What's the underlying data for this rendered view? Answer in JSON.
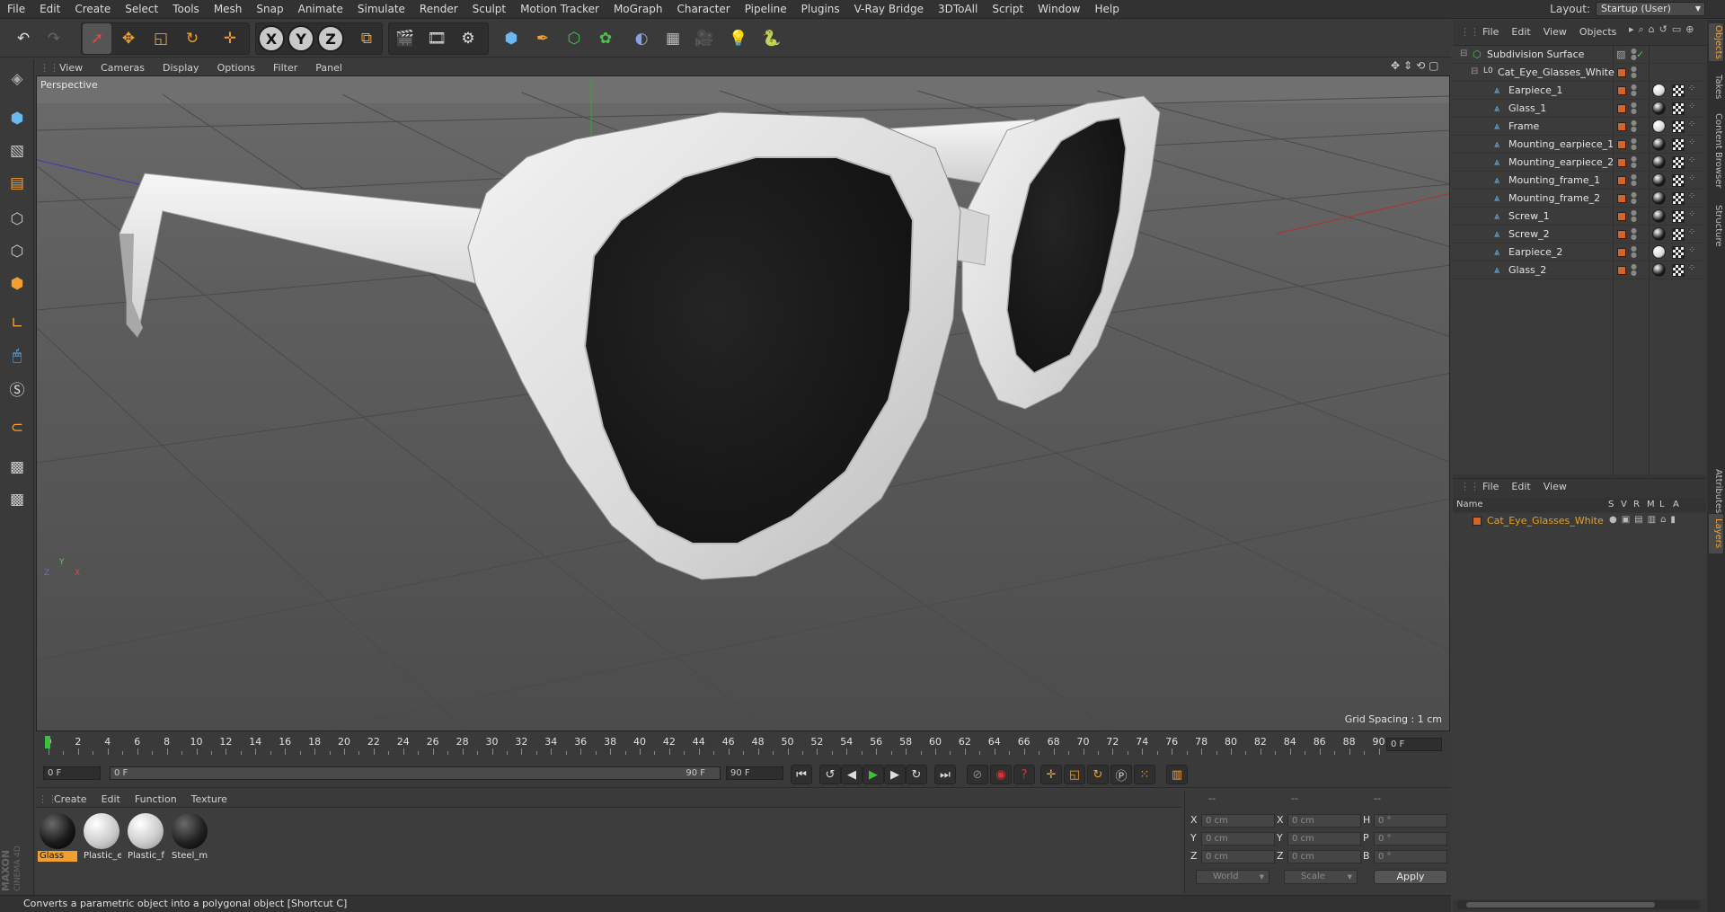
{
  "menubar": {
    "items": [
      "File",
      "Edit",
      "Create",
      "Select",
      "Tools",
      "Mesh",
      "Snap",
      "Animate",
      "Simulate",
      "Render",
      "Sculpt",
      "Motion Tracker",
      "MoGraph",
      "Character",
      "Pipeline",
      "Plugins",
      "V-Ray Bridge",
      "3DToAll",
      "Script",
      "Window",
      "Help"
    ],
    "layout_label": "Layout:",
    "layout_value": "Startup (User)"
  },
  "toolbar": {
    "x_label": "X",
    "y_label": "Y",
    "z_label": "Z"
  },
  "viewport": {
    "menu": [
      "View",
      "Cameras",
      "Display",
      "Options",
      "Filter",
      "Panel"
    ],
    "label": "Perspective",
    "grid_spacing": "Grid Spacing : 1 cm",
    "axis_x": "X",
    "axis_y": "Y",
    "axis_z": "Z"
  },
  "timeline": {
    "ticks": [
      "0",
      "2",
      "4",
      "6",
      "8",
      "10",
      "12",
      "14",
      "16",
      "18",
      "20",
      "22",
      "24",
      "26",
      "28",
      "30",
      "32",
      "34",
      "36",
      "38",
      "40",
      "42",
      "44",
      "46",
      "48",
      "50",
      "52",
      "54",
      "56",
      "58",
      "60",
      "62",
      "64",
      "66",
      "68",
      "70",
      "72",
      "74",
      "76",
      "78",
      "80",
      "82",
      "84",
      "86",
      "88",
      "90"
    ],
    "current_frame": "0 F",
    "start_field": "0 F",
    "range_start": "0 F",
    "range_end": "90 F",
    "end_field": "90 F"
  },
  "materials": {
    "menu": [
      "Create",
      "Edit",
      "Function",
      "Texture"
    ],
    "items": [
      {
        "name": "Glass",
        "color": "#1a1a1a",
        "selected": true
      },
      {
        "name": "Plastic_e",
        "color": "#e8e8e8",
        "selected": false
      },
      {
        "name": "Plastic_f",
        "color": "#e8e8e8",
        "selected": false
      },
      {
        "name": "Steel_m",
        "color": "#222222",
        "selected": false
      }
    ]
  },
  "coordinates": {
    "header_a": "--",
    "header_b": "--",
    "header_c": "--",
    "rows": [
      {
        "l1": "X",
        "v1": "0 cm",
        "l2": "X",
        "v2": "0 cm",
        "l3": "H",
        "v3": "0 °"
      },
      {
        "l1": "Y",
        "v1": "0 cm",
        "l2": "Y",
        "v2": "0 cm",
        "l3": "P",
        "v3": "0 °"
      },
      {
        "l1": "Z",
        "v1": "0 cm",
        "l2": "Z",
        "v2": "0 cm",
        "l3": "B",
        "v3": "0 °"
      }
    ],
    "space": "World",
    "mode": "Scale",
    "apply": "Apply"
  },
  "status": "Converts a parametric object into a polygonal object [Shortcut C]",
  "objects": {
    "menu": [
      "File",
      "Edit",
      "View",
      "Objects"
    ],
    "items": [
      {
        "name": "Subdivision Surface",
        "indent": 0,
        "icon": "subdivision-icon",
        "mat": null
      },
      {
        "name": "Cat_Eye_Glasses_White",
        "indent": 1,
        "icon": "null-object-icon",
        "mat": null
      },
      {
        "name": "Earpiece_1",
        "indent": 2,
        "icon": "polygon-icon",
        "mat": "#d8d8d8"
      },
      {
        "name": "Glass_1",
        "indent": 2,
        "icon": "polygon-icon",
        "mat": "#1c1c1c"
      },
      {
        "name": "Frame",
        "indent": 2,
        "icon": "polygon-icon",
        "mat": "#d8d8d8"
      },
      {
        "name": "Mounting_earpiece_1",
        "indent": 2,
        "icon": "polygon-icon",
        "mat": "#1c1c1c"
      },
      {
        "name": "Mounting_earpiece_2",
        "indent": 2,
        "icon": "polygon-icon",
        "mat": "#1c1c1c"
      },
      {
        "name": "Mounting_frame_1",
        "indent": 2,
        "icon": "polygon-icon",
        "mat": "#1c1c1c"
      },
      {
        "name": "Mounting_frame_2",
        "indent": 2,
        "icon": "polygon-icon",
        "mat": "#1c1c1c"
      },
      {
        "name": "Screw_1",
        "indent": 2,
        "icon": "polygon-icon",
        "mat": "#1c1c1c"
      },
      {
        "name": "Screw_2",
        "indent": 2,
        "icon": "polygon-icon",
        "mat": "#1c1c1c"
      },
      {
        "name": "Earpiece_2",
        "indent": 2,
        "icon": "polygon-icon",
        "mat": "#d8d8d8"
      },
      {
        "name": "Glass_2",
        "indent": 2,
        "icon": "polygon-icon",
        "mat": "#1c1c1c"
      }
    ]
  },
  "layers": {
    "menu": [
      "File",
      "Edit",
      "View"
    ],
    "columns": [
      "Name",
      "S",
      "V",
      "R",
      "M",
      "L",
      "A"
    ],
    "items": [
      {
        "name": "Cat_Eye_Glasses_White",
        "color": "#d5642b"
      }
    ]
  },
  "side_tabs": [
    "Objects",
    "Takes",
    "Content Browser",
    "Structure",
    "Attributes",
    "Layers"
  ],
  "colors": {
    "accent_orange": "#f0a030",
    "layer_name": "#e8a020"
  }
}
